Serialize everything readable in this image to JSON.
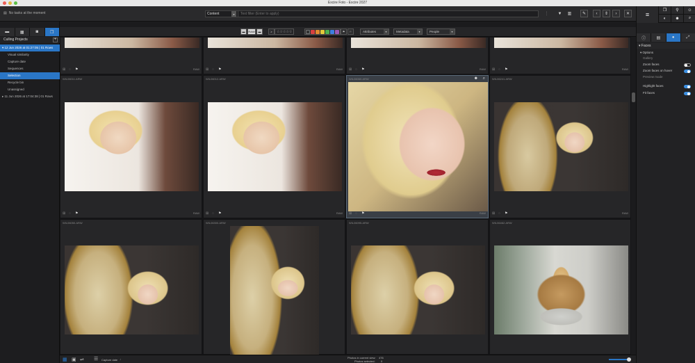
{
  "window": {
    "title": "Excire Foto - Excire 2027"
  },
  "toolbar": {
    "tasks_text": "No tasks at the moment",
    "filter_field": "Content",
    "filter_placeholder": "Text filter (Enter to apply)"
  },
  "left_panel": {
    "header": "Culling Projects",
    "items": [
      {
        "label": "12 Jun 2026 at 01:27:05 | 01 Rows",
        "selected": true
      },
      {
        "label": "Visual similarity"
      },
      {
        "label": "Capture date"
      },
      {
        "label": "Sequences"
      },
      {
        "label": "Selection",
        "selected": true
      },
      {
        "label": "Recycle bin"
      },
      {
        "label": "Unassigned"
      },
      {
        "label": "11 Jun 2026 at 17:04:38 | 01 Rows"
      }
    ]
  },
  "viewbar": {
    "raw_label": "RAW",
    "stars": "☆☆☆☆☆",
    "color_labels": [
      "#d84040",
      "#e08a30",
      "#e3c83a",
      "#4caf50",
      "#3d7fe0",
      "#9b59b6"
    ],
    "attributes": "Attributes",
    "metadata": "Metadata",
    "people": "People"
  },
  "grid": {
    "cells": [
      {
        "name": "",
        "format": "RAW"
      },
      {
        "name": "",
        "format": "RAW"
      },
      {
        "name": "",
        "format": "RAW"
      },
      {
        "name": "",
        "format": "RAW"
      },
      {
        "name": "WIL06011.ARW",
        "format": "RAW"
      },
      {
        "name": "WIL06012.ARW",
        "format": "RAW"
      },
      {
        "name": "WIL06060.ARW",
        "format": "RAW"
      },
      {
        "name": "WIL06241.ARW",
        "format": "RAW"
      },
      {
        "name": "WIL06050.ARW",
        "format": ""
      },
      {
        "name": "WIL06300.ARW",
        "format": ""
      },
      {
        "name": "WIL06095.ARW",
        "format": ""
      },
      {
        "name": "WIL06462.ARW",
        "format": ""
      }
    ]
  },
  "right_panel": {
    "title": "Faces",
    "options_label": "Options",
    "gallery_label": "Gallery",
    "zoom_faces": "Zoom faces",
    "zoom_faces_hover": "Zoom faces on hover",
    "preview_mode": "Preview mode",
    "highlight_faces": "Highlight faces",
    "fit_faces": "Fit faces"
  },
  "status": {
    "sort_label": "Capture date",
    "photos_in_view_label": "Photos in current view:",
    "photos_in_view": "476",
    "photos_selected_label": "Photos selected:",
    "photos_selected": "0"
  }
}
